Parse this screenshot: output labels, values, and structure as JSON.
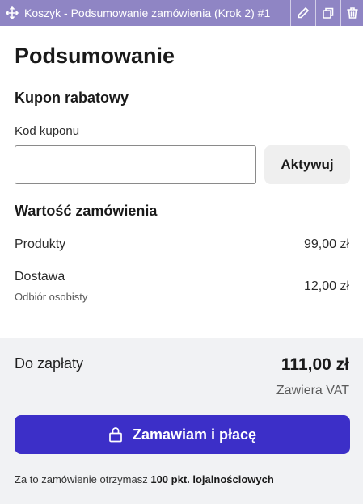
{
  "toolbar": {
    "title": "Koszyk - Podsumowanie zamówienia (Krok 2) #1",
    "move_icon": "move-icon",
    "edit_icon": "pencil-icon",
    "duplicate_icon": "duplicate-icon",
    "delete_icon": "trash-icon"
  },
  "page": {
    "title": "Podsumowanie"
  },
  "coupon": {
    "heading": "Kupon rabatowy",
    "field_label": "Kod kuponu",
    "value": "",
    "activate_label": "Aktywuj"
  },
  "order_value": {
    "heading": "Wartość zamówienia",
    "rows": [
      {
        "label": "Produkty",
        "sub": "",
        "value": "99,00 zł"
      },
      {
        "label": "Dostawa",
        "sub": "Odbiór osobisty",
        "value": "12,00 zł"
      }
    ]
  },
  "summary": {
    "pay_label": "Do zapłaty",
    "pay_value": "111,00 zł",
    "vat_note": "Zawiera VAT",
    "order_button_label": "Zamawiam i płacę",
    "loyalty_prefix": "Za to zamówienie otrzymasz ",
    "loyalty_points": "100 pkt. lojalnościowych"
  },
  "colors": {
    "toolbar_bg": "#8f85c4",
    "primary_button": "#3c2fc8",
    "summary_bg": "#f1f2f4",
    "secondary_button": "#efefef"
  }
}
